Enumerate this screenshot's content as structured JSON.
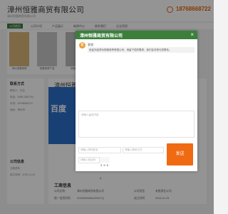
{
  "header": {
    "company_name": "漳州恒雅商贸有限公司",
    "subtitle": "漳州恒雅商贸有限公司",
    "phone": "18768668722"
  },
  "nav": {
    "items": [
      "公司首页",
      "公司介绍",
      "产品展示",
      "新闻中心",
      "联系我们",
      "企业资质"
    ]
  },
  "gallery": {
    "captions": [
      "漳州恒雅商贸",
      "恒雅商贸产品",
      "恒雅商贸"
    ]
  },
  "sidebar": {
    "contact_title": "联系方式",
    "contact_rows": [
      "联系人：先生",
      "电话：0596-2081794",
      "手机：18768668722",
      "地址：漳州市"
    ],
    "info_title": "公司信息",
    "info_rows": [
      "注册资本",
      "成立时间：2015-11-23"
    ]
  },
  "main": {
    "title": "漳州恒雅商贸有限公司",
    "banner_text": "百度",
    "business_title": "工商信息",
    "business_rows": [
      [
        "公司名称",
        "漳州恒雅商贸有限公司",
        "公司类型",
        "有限责任公司"
      ],
      [
        "统一信用代码",
        "91350600MA2XNXYQ",
        "成立时间",
        "2015-11-23"
      ]
    ]
  },
  "dialog": {
    "title": "漳州恒雅商贸有限公司",
    "close_label": "×",
    "avatar_text": "客",
    "sender": "客服",
    "message": "欢迎光临漳州恒雅商贸有限公司，请留下您的需求，我们会尽快与您联系。",
    "message_placeholder": "请输入留言内容",
    "name_placeholder": "请输入您的姓名",
    "phone_placeholder": "请输入联系方式",
    "captcha_placeholder": "请输入验证码",
    "captcha_text": "3 9 5 8",
    "submit_label": "发送"
  },
  "colors": {
    "brand_green": "#3b7f3b",
    "accent_orange": "#f06a12"
  }
}
